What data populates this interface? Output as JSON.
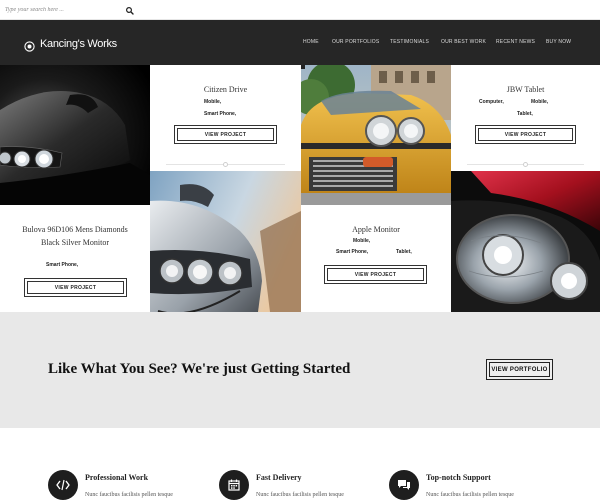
{
  "search": {
    "placeholder": "Type your search here ..."
  },
  "brand": {
    "name": "Kancing's Works"
  },
  "nav": {
    "items": [
      "Home",
      "Our Portfolios",
      "Testimonials",
      "Our Best Work",
      "Recent News",
      "Buy Now"
    ]
  },
  "portfolio": {
    "button_label": "VIEW PROJECT",
    "cards": [
      {
        "title": "Citizen Drive",
        "tags": [
          "Mobile,",
          "Smart Phone,"
        ]
      },
      {
        "title": "JBW Tablet",
        "tags": [
          "Computer,",
          "Mobile,",
          "Tablet,"
        ]
      },
      {
        "title": "Bulova 96D106 Mens Diamonds Black Silver Monitor",
        "tags": [
          "Smart Phone,"
        ]
      },
      {
        "title": "Apple Monitor",
        "tags": [
          "Mobile,",
          "Smart Phone,",
          "Tablet,"
        ]
      }
    ],
    "images": [
      {
        "name": "black-car-headlight-photo"
      },
      {
        "name": "yellow-taxi-photo"
      },
      {
        "name": "silver-car-front-photo"
      },
      {
        "name": "red-car-headlight-photo"
      }
    ]
  },
  "cta": {
    "heading": "Like What You See? We're just Getting Started",
    "button_label": "VIEW PORTFOLIO"
  },
  "features": [
    {
      "icon": "code-icon",
      "title": "Professional Work",
      "text": "Nunc faucibus facilisis pellen tesque"
    },
    {
      "icon": "calendar-icon",
      "title": "Fast Delivery",
      "text": "Nunc faucibus facilisis pellen tesque"
    },
    {
      "icon": "chat-icon",
      "title": "Top-notch Support",
      "text": "Nunc faucibus facilisis pellen tesque"
    }
  ],
  "colors": {
    "header_bg": "#262626",
    "cta_bg": "#e8e8e8",
    "text_dark": "#222222",
    "taxi_yellow": "#e0a42a",
    "car_red": "#b81424"
  }
}
